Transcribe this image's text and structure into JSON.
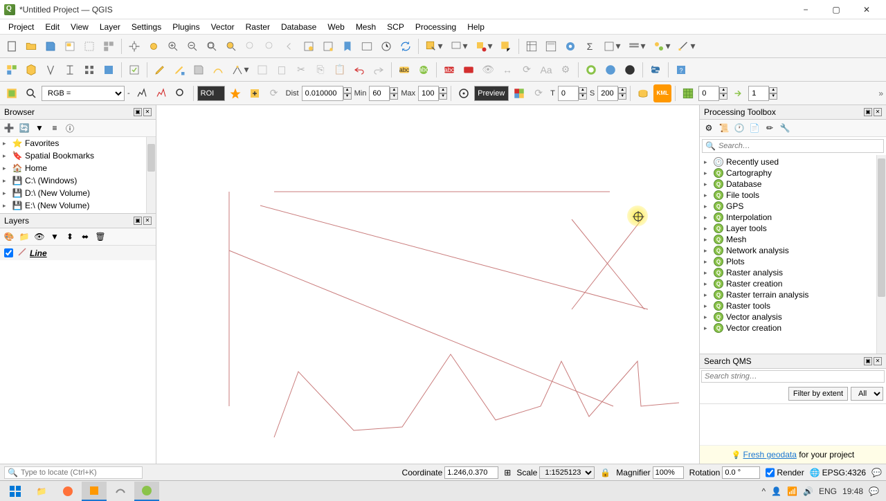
{
  "window": {
    "title": "*Untitled Project — QGIS"
  },
  "menu": [
    "Project",
    "Edit",
    "View",
    "Layer",
    "Settings",
    "Plugins",
    "Vector",
    "Raster",
    "Database",
    "Web",
    "Mesh",
    "SCP",
    "Processing",
    "Help"
  ],
  "toolbar3": {
    "rgb_label": "RGB = ",
    "rgb_value": "-",
    "roi_label": "ROI",
    "dist_label": "Dist",
    "dist_value": "0.010000",
    "min_label": "Min",
    "min_value": "60",
    "max_label": "Max",
    "max_value": "100",
    "preview_label": "Preview",
    "t_label": "T",
    "t_value": "0",
    "s_label": "S",
    "s_value": "200",
    "extra1": "0",
    "extra2": "1"
  },
  "browser": {
    "title": "Browser",
    "items": [
      {
        "icon": "star",
        "label": "Favorites",
        "expand": "▶"
      },
      {
        "icon": "bookmark",
        "label": "Spatial Bookmarks",
        "expand": "▶"
      },
      {
        "icon": "home",
        "label": "Home",
        "expand": "▶"
      },
      {
        "icon": "drive",
        "label": "C:\\ (Windows)",
        "expand": "▶"
      },
      {
        "icon": "drive",
        "label": "D:\\ (New Volume)",
        "expand": "▶"
      },
      {
        "icon": "drive",
        "label": "E:\\ (New Volume)",
        "expand": "▶"
      }
    ]
  },
  "layers": {
    "title": "Layers",
    "items": [
      {
        "checked": true,
        "name": "Line"
      }
    ]
  },
  "processing": {
    "title": "Processing Toolbox",
    "search_placeholder": "Search…",
    "categories": [
      {
        "label": "Recently used",
        "icon": "recent"
      },
      {
        "label": "Cartography",
        "icon": "q"
      },
      {
        "label": "Database",
        "icon": "q"
      },
      {
        "label": "File tools",
        "icon": "q"
      },
      {
        "label": "GPS",
        "icon": "q"
      },
      {
        "label": "Interpolation",
        "icon": "q"
      },
      {
        "label": "Layer tools",
        "icon": "q"
      },
      {
        "label": "Mesh",
        "icon": "q"
      },
      {
        "label": "Network analysis",
        "icon": "q"
      },
      {
        "label": "Plots",
        "icon": "q"
      },
      {
        "label": "Raster analysis",
        "icon": "q"
      },
      {
        "label": "Raster creation",
        "icon": "q"
      },
      {
        "label": "Raster terrain analysis",
        "icon": "q"
      },
      {
        "label": "Raster tools",
        "icon": "q"
      },
      {
        "label": "Vector analysis",
        "icon": "q"
      },
      {
        "label": "Vector creation",
        "icon": "q"
      }
    ]
  },
  "qms": {
    "title": "Search QMS",
    "search_placeholder": "Search string…",
    "filter_btn": "Filter by extent",
    "filter_all": "All",
    "footer_link": "Fresh geodata",
    "footer_text": " for your project"
  },
  "statusbar": {
    "locator_placeholder": "Type to locate (Ctrl+K)",
    "coord_label": "Coordinate",
    "coord_value": "1.246,0.370",
    "scale_label": "Scale",
    "scale_value": "1:1525123",
    "magnifier_label": "Magnifier",
    "magnifier_value": "100%",
    "rotation_label": "Rotation",
    "rotation_value": "0.0 °",
    "render_label": "Render",
    "epsg": "EPSG:4326"
  },
  "taskbar": {
    "lang": "ENG",
    "time": "19:48"
  }
}
